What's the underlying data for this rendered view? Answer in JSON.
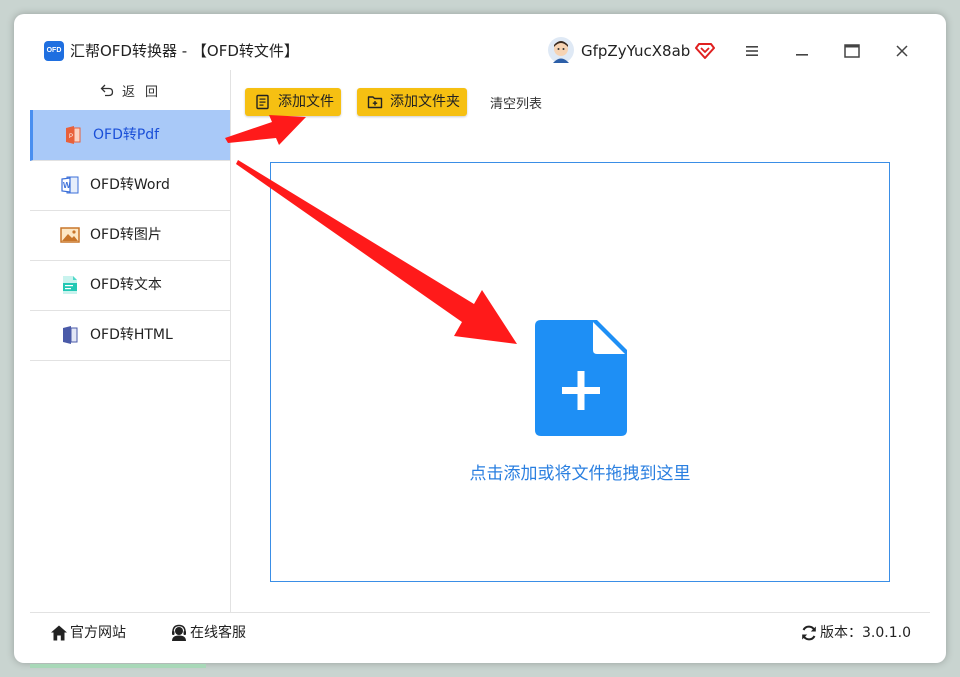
{
  "app": {
    "logo_text": "OFD",
    "title": "汇帮OFD转换器 - 【OFD转文件】"
  },
  "user": {
    "name": "GfpZyYucX8ab"
  },
  "window_controls": [
    "menu-icon",
    "minimize-icon",
    "maximize-icon",
    "close-icon"
  ],
  "sidebar": {
    "back_label": "返回",
    "items": [
      {
        "label": "OFD转Pdf",
        "icon": "pdf-icon",
        "active": true
      },
      {
        "label": "OFD转Word",
        "icon": "word-icon",
        "active": false
      },
      {
        "label": "OFD转图片",
        "icon": "image-icon",
        "active": false
      },
      {
        "label": "OFD转文本",
        "icon": "text-file-icon",
        "active": false
      },
      {
        "label": "OFD转HTML",
        "icon": "html-icon",
        "active": false
      }
    ]
  },
  "toolbar": {
    "add_file": "添加文件",
    "add_folder": "添加文件夹",
    "clear_list": "清空列表"
  },
  "dropzone": {
    "hint": "点击添加或将文件拖拽到这里"
  },
  "footer": {
    "website": "官方网站",
    "support": "在线客服",
    "version": "版本：3.0.1.0"
  },
  "colors": {
    "accent_yellow": "#f6c012",
    "active_nav_bg": "#a9c9f8",
    "primary_blue": "#2a7fe0",
    "arrow_red": "#ff1a1a"
  }
}
